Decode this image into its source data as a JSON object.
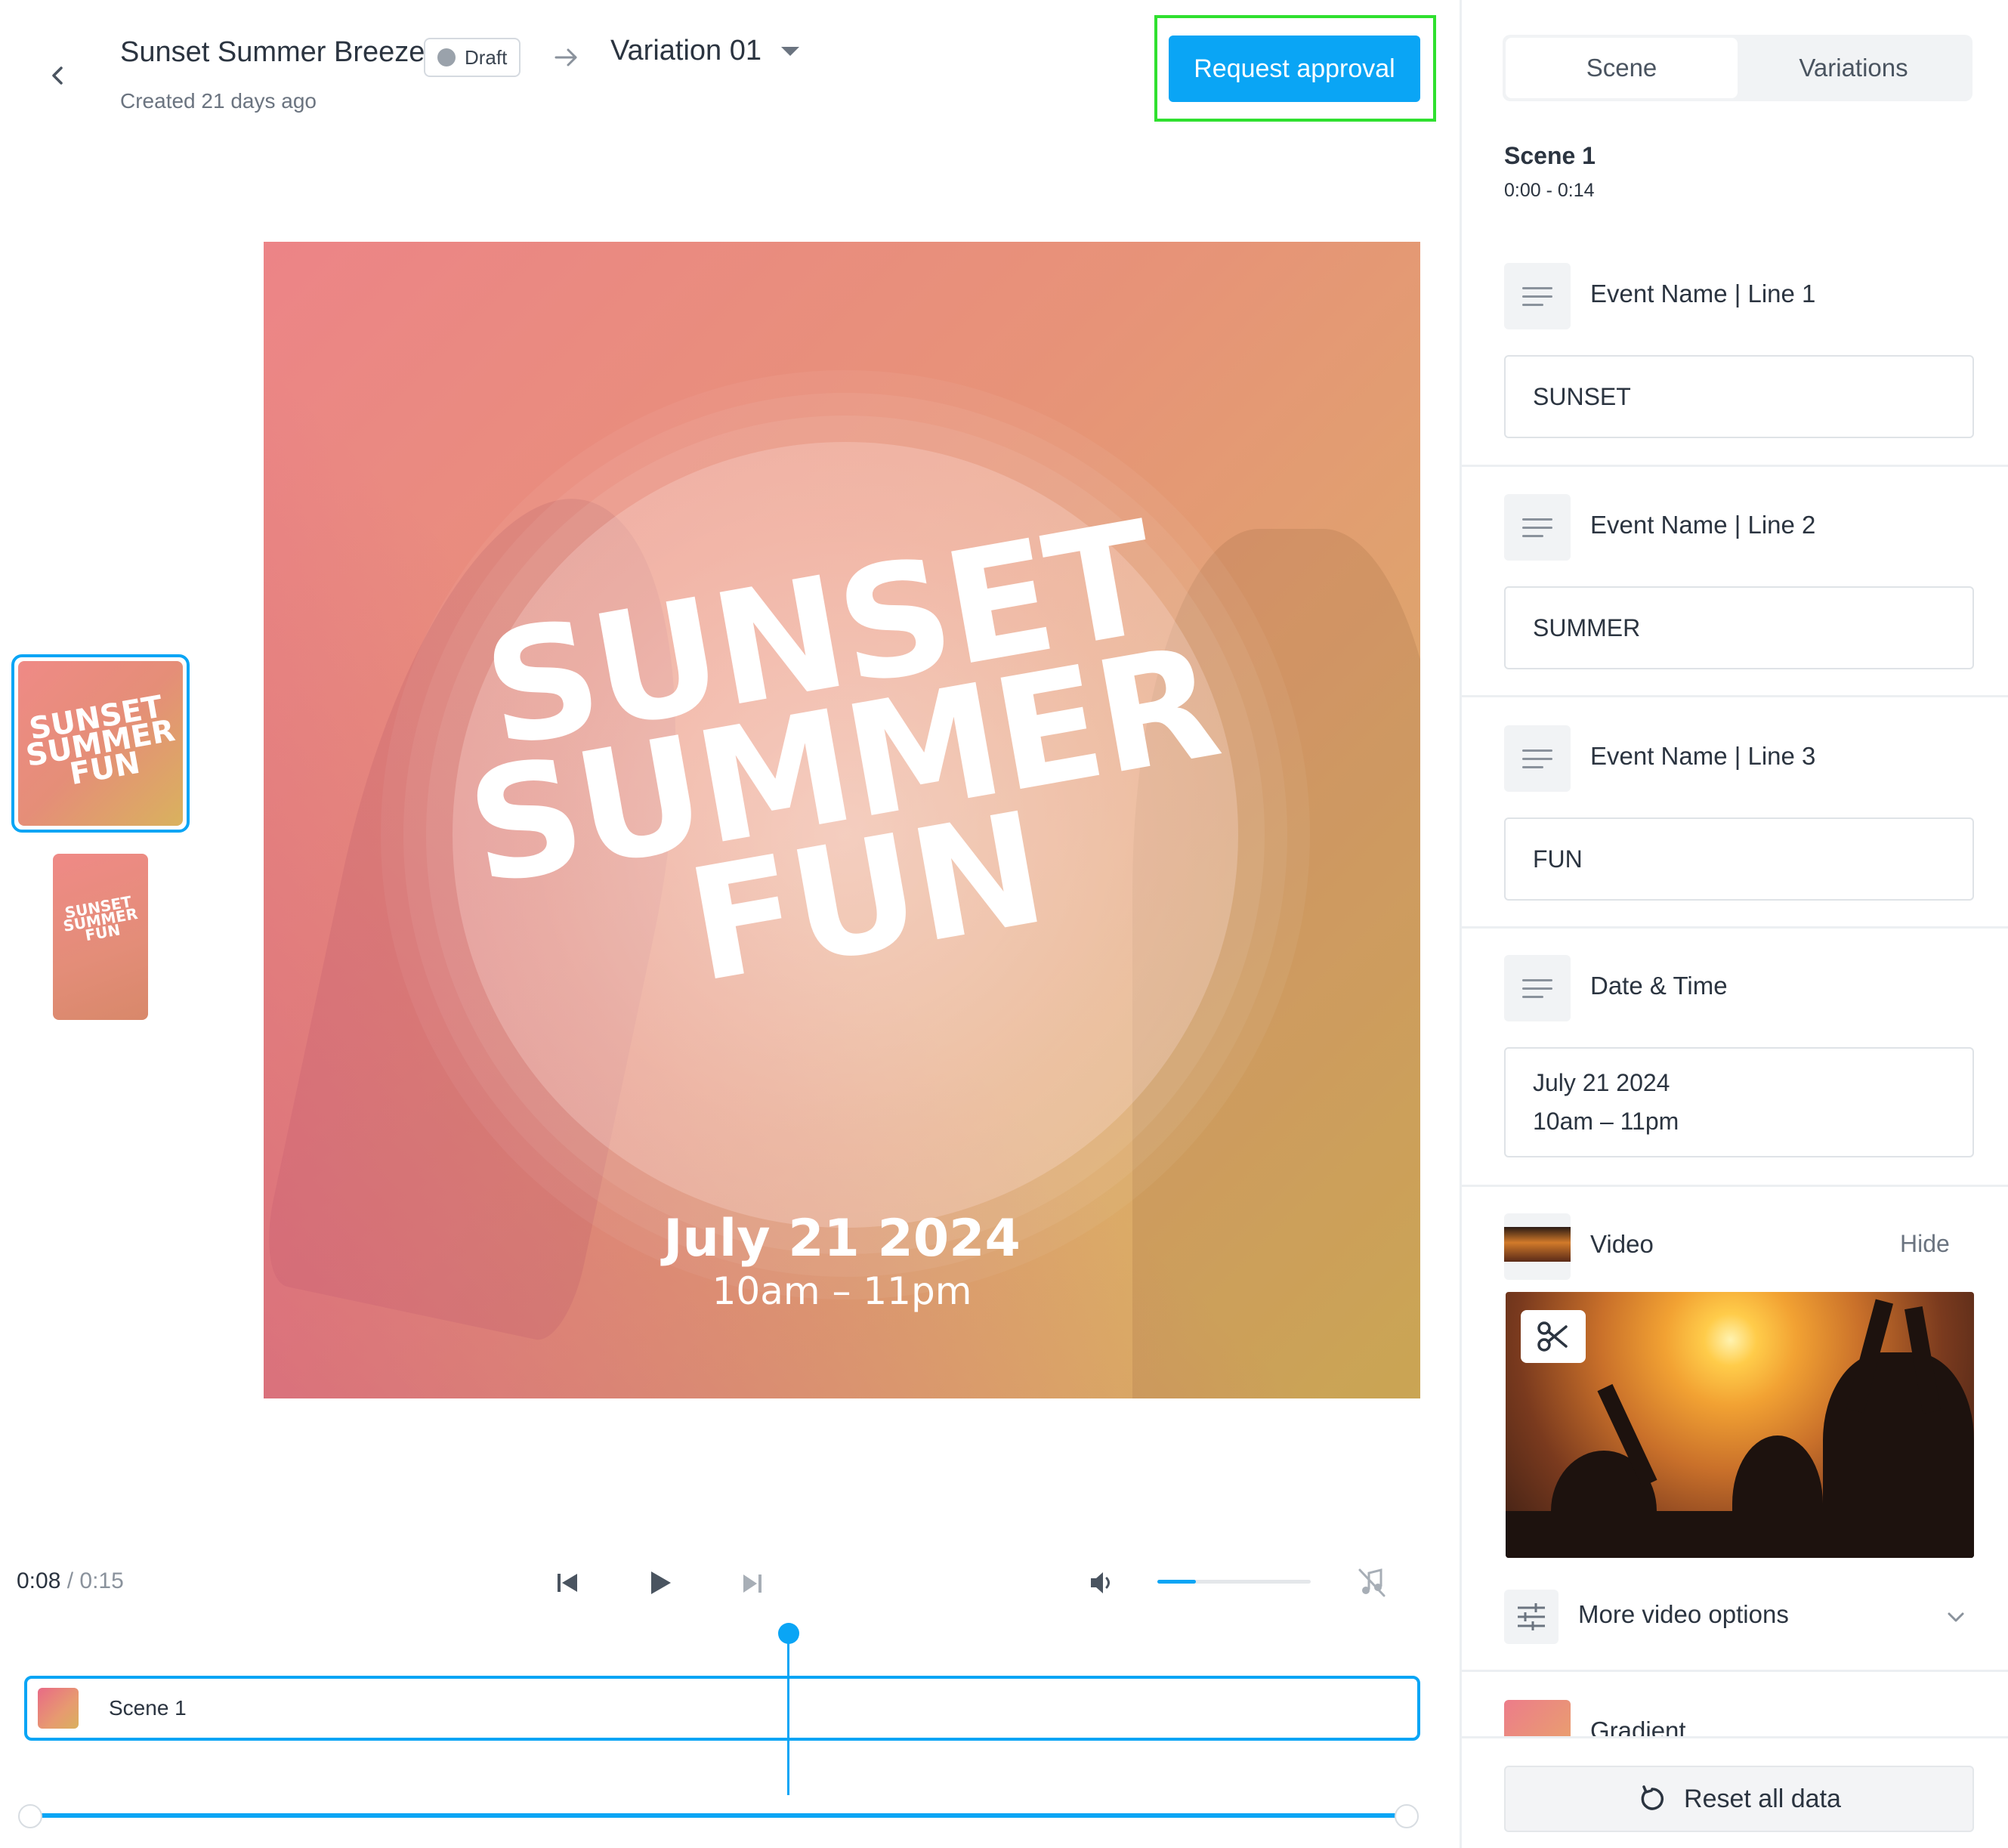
{
  "header": {
    "project_title": "Sunset Summer Breeze",
    "status_badge": "Draft",
    "variation": "Variation 01",
    "created": "Created 21 days ago",
    "request_approval_label": "Request approval",
    "accent_color": "#0aa5f5",
    "highlight_color": "#2fe02f"
  },
  "thumbnails": [
    {
      "lines": [
        "SUNSET",
        "SUMMER",
        "FUN"
      ],
      "selected": true
    },
    {
      "lines": [
        "SUNSET",
        "SUMMER",
        "FUN"
      ],
      "selected": false
    }
  ],
  "preview": {
    "line1": "SUNSET",
    "line2": "SUMMER",
    "line3": "FUN",
    "date": "July 21 2024",
    "time": "10am – 11pm"
  },
  "player": {
    "current_time": "0:08",
    "total_time": "/ 0:15",
    "volume_fraction": 0.25,
    "playhead_fraction": 0.53,
    "icons": [
      "skip-back-icon",
      "play-icon",
      "skip-forward-icon",
      "volume-icon",
      "music-off-icon"
    ]
  },
  "timeline": {
    "scene_label": "Scene 1"
  },
  "sidebar": {
    "tabs": [
      "Scene",
      "Variations"
    ],
    "active_tab": "Scene",
    "scene_title": "Scene 1",
    "scene_range": "0:00 - 0:14",
    "fields": [
      {
        "label": "Event Name | Line 1",
        "value": "SUNSET"
      },
      {
        "label": "Event Name | Line 2",
        "value": "SUMMER"
      },
      {
        "label": "Event Name | Line 3",
        "value": "FUN"
      },
      {
        "label": "Date & Time",
        "value_line1": "July 21 2024",
        "value_line2": "10am – 11pm"
      }
    ],
    "video": {
      "label": "Video",
      "hide_label": "Hide"
    },
    "more_video_options": "More video options",
    "gradient_label": "Gradient",
    "reset_label": "Reset all data"
  }
}
